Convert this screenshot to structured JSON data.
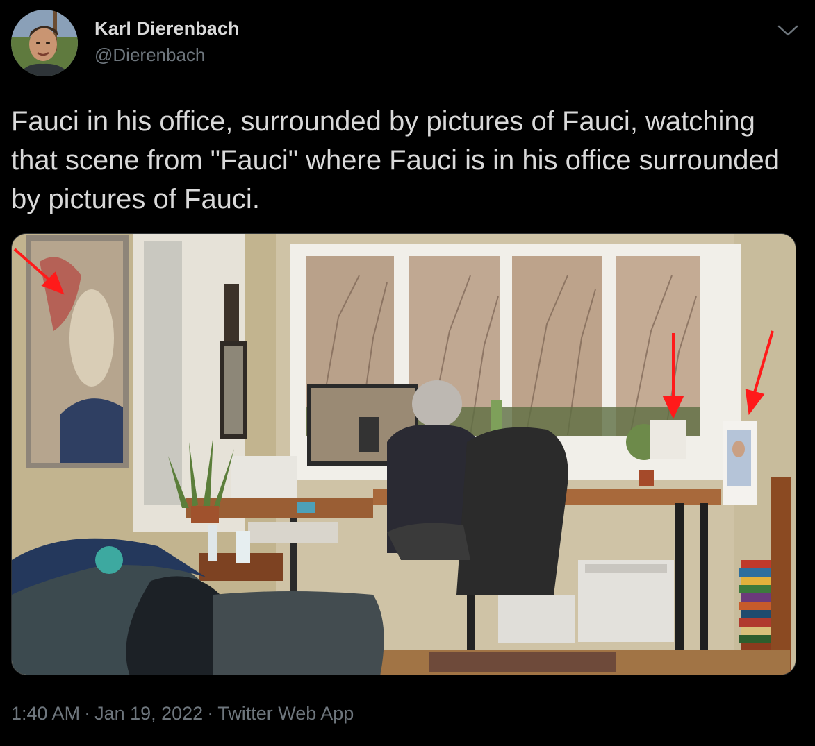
{
  "author": {
    "display_name": "Karl Dierenbach",
    "handle": "@Dierenbach"
  },
  "tweet": {
    "text": "Fauci in his office, surrounded by pictures of Fauci, watching that scene from \"Fauci\" where Fauci is in his office surrounded by pictures of Fauci."
  },
  "meta": {
    "time": "1:40 AM",
    "separator": "·",
    "date": "Jan 19, 2022",
    "source": "Twitter Web App"
  },
  "icons": {
    "more": "chevron-down-icon"
  },
  "colors": {
    "background": "#000000",
    "primary_text": "#d9d9d9",
    "secondary_text": "#6e767d",
    "annotation_arrow": "#ff1a1a"
  }
}
